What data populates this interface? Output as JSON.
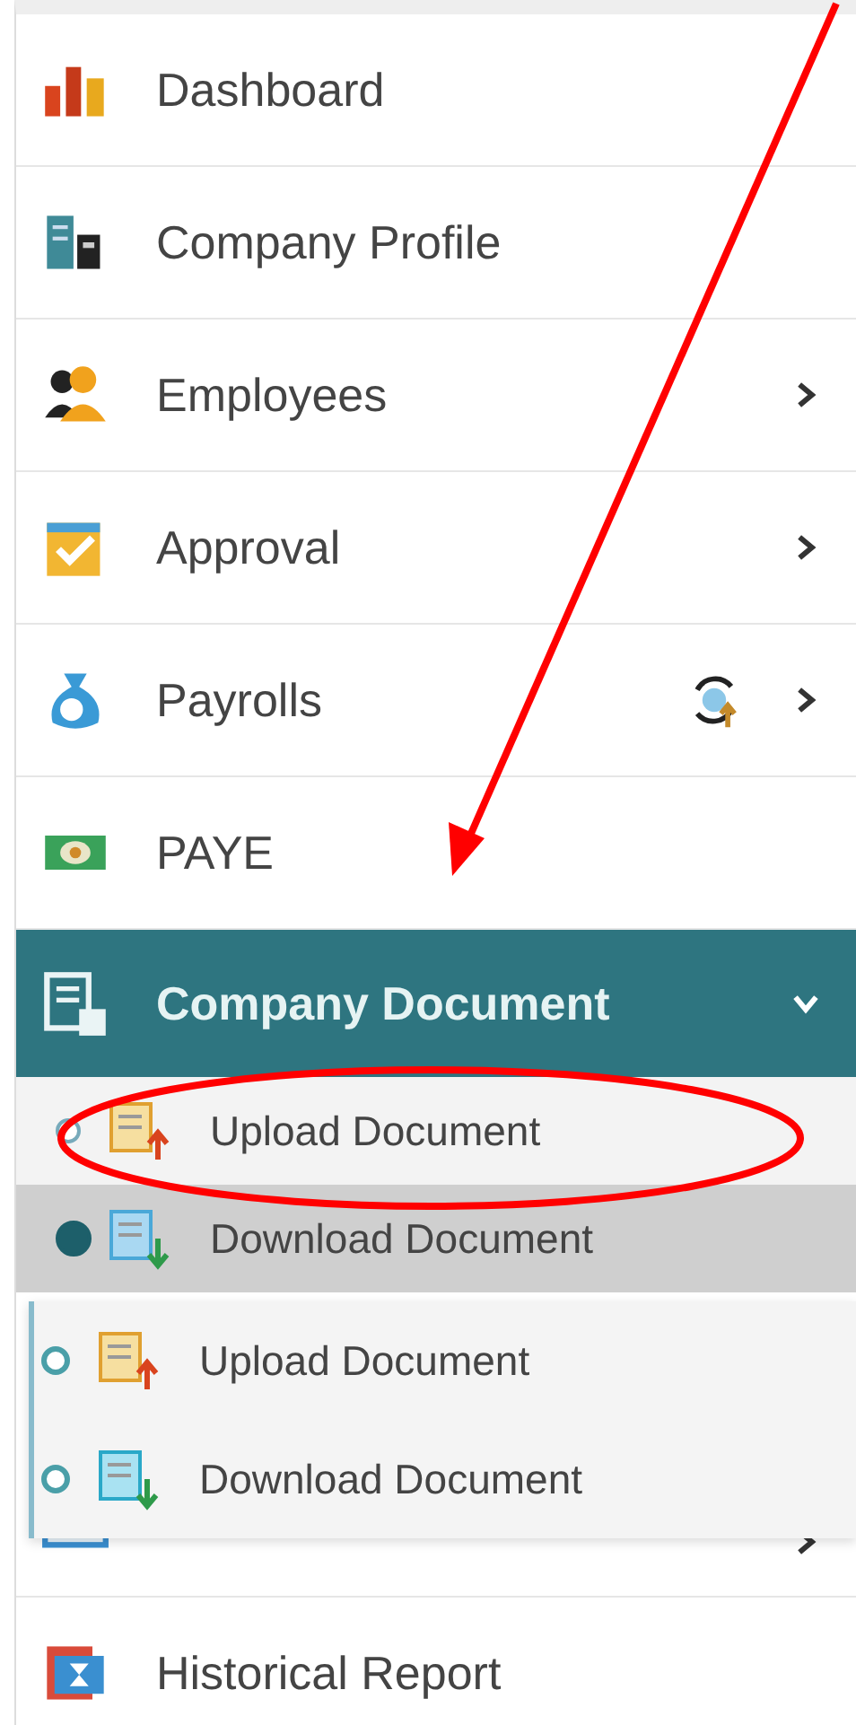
{
  "menu": [
    {
      "kind": "item",
      "label": "Dashboard",
      "has_submenu": false
    },
    {
      "kind": "item",
      "label": "Company Profile",
      "has_submenu": false
    },
    {
      "kind": "item",
      "label": "Employees",
      "has_submenu": true
    },
    {
      "kind": "item",
      "label": "Approval",
      "has_submenu": true
    },
    {
      "kind": "item",
      "label": "Payrolls",
      "has_submenu": true
    },
    {
      "kind": "item",
      "label": "PAYE",
      "has_submenu": false
    },
    {
      "kind": "group",
      "label": "Company Document",
      "expanded": true,
      "children": [
        {
          "label": "Upload Document",
          "selected": false
        },
        {
          "label": "Download Document",
          "selected": true
        }
      ]
    },
    {
      "kind": "covered",
      "has_submenu": true
    },
    {
      "kind": "item",
      "label": "Historical Report",
      "has_submenu": false
    }
  ],
  "flyout": {
    "items": [
      {
        "label": "Upload Document"
      },
      {
        "label": "Download Document"
      }
    ]
  }
}
